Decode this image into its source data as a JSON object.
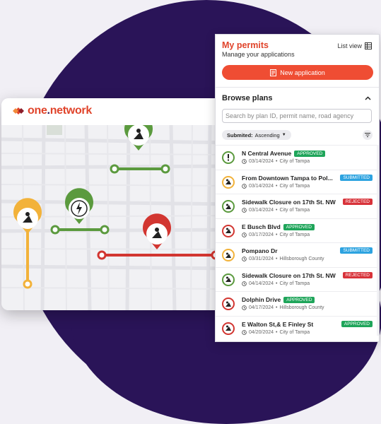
{
  "logo": {
    "text_one": "one",
    "text_dot": ".",
    "text_network": "network"
  },
  "panel": {
    "title": "My permits",
    "subtitle": "Manage your applications",
    "list_view_label": "List view",
    "new_button_label": "New application",
    "browse_title": "Browse plans",
    "search_placeholder": "Search by plan ID, permit name, road agency",
    "sort_key": "Submited:",
    "sort_value": "Ascending"
  },
  "colors": {
    "brand": "#e0442b",
    "approved": "#1fa55a",
    "submitted": "#2da3e0",
    "rejected": "#d8333a",
    "green_marker": "#5b9a3e",
    "yellow_marker": "#f2b23a",
    "red_marker": "#d23631"
  },
  "permits": [
    {
      "name": "N Central Avenue",
      "date": "03/14/2024",
      "agency": "City of Tampa",
      "status": "APPROVED",
      "icon": "alert-icon",
      "ring": "#5b9a3e"
    },
    {
      "name": "From Downtown Tampa to Pol...",
      "date": "03/14/2024",
      "agency": "City of Tampa",
      "status": "SUBMITTED",
      "icon": "roadwork-icon",
      "ring": "#f2b23a"
    },
    {
      "name": "Sidewalk Closure on 17th St. NW",
      "date": "03/14/2024",
      "agency": "City of Tampa",
      "status": "REJECTED",
      "icon": "roadwork-icon",
      "ring": "#5b9a3e"
    },
    {
      "name": "E Busch Blvd",
      "date": "03/17/2024",
      "agency": "City of Tampa",
      "status": "APPROVED",
      "icon": "roadwork-icon",
      "ring": "#d23631"
    },
    {
      "name": "Pompano Dr",
      "date": "03/31/2024",
      "agency": "Hillsborough County",
      "status": "SUBMITTED",
      "icon": "roadwork-icon",
      "ring": "#f2b23a"
    },
    {
      "name": "Sidewalk Closure on 17th St. NW",
      "date": "04/14/2024",
      "agency": "City of Tampa",
      "status": "REJECTED",
      "icon": "roadwork-icon",
      "ring": "#5b9a3e"
    },
    {
      "name": "Dolphin Drive",
      "date": "04/17/2024",
      "agency": "Hillsborough County",
      "status": "APPROVED",
      "icon": "roadwork-icon",
      "ring": "#d23631"
    },
    {
      "name": "E Walton St,& E Finley St",
      "date": "04/20/2024",
      "agency": "City of Tampa",
      "status": "APPROVED",
      "icon": "roadwork-icon",
      "ring": "#d23631"
    }
  ]
}
